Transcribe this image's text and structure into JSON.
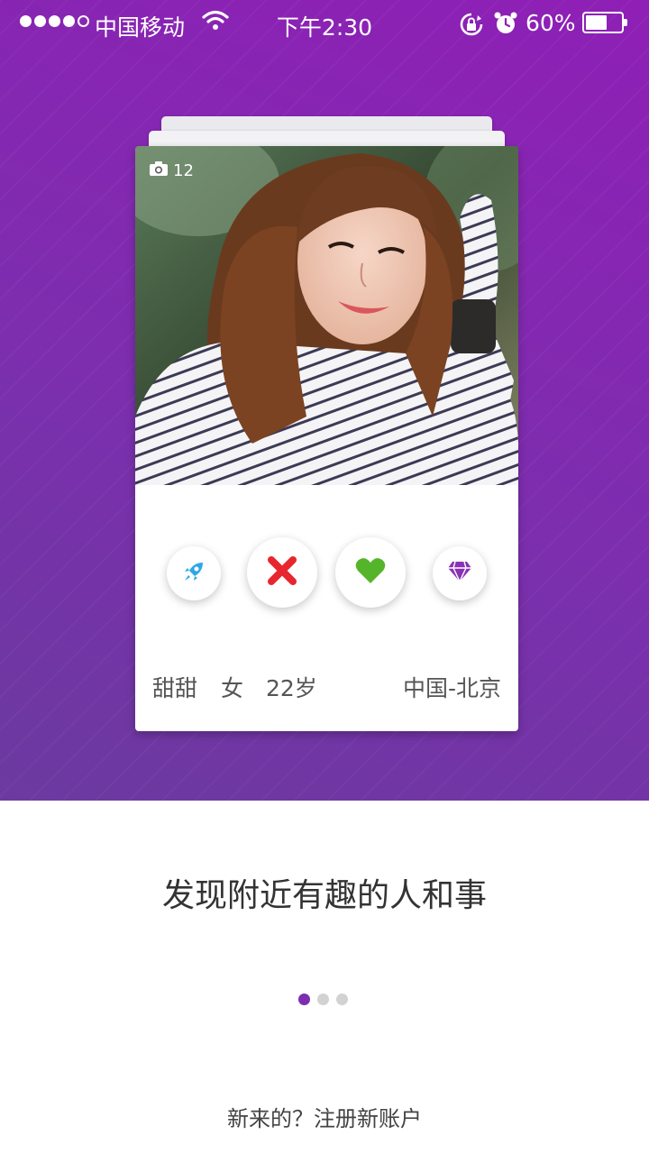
{
  "status_bar": {
    "signal_filled": 4,
    "carrier": "中国移动",
    "time": "下午2:30",
    "battery_percent": "60%",
    "battery_level": 0.6,
    "icons": [
      "signal-dots",
      "wifi-icon",
      "rotation-lock-icon",
      "alarm-clock-icon",
      "battery-icon"
    ]
  },
  "colors": {
    "hero_gradient_top": "#8f1fb6",
    "hero_gradient_bottom": "#6b3a9f",
    "reject": "#e8262e",
    "like": "#55b52a",
    "rocket": "#2ea7e8",
    "diamond": "#8a32b4",
    "page_dot_active": "#7b2fb0"
  },
  "card": {
    "photo_count": "12",
    "photo_icon": "camera-icon",
    "actions": [
      {
        "name": "boost",
        "icon": "rocket-icon"
      },
      {
        "name": "reject",
        "icon": "close-icon"
      },
      {
        "name": "like",
        "icon": "heart-icon"
      },
      {
        "name": "super-like",
        "icon": "diamond-icon"
      }
    ],
    "profile": {
      "name": "甜甜",
      "gender": "女",
      "age": "22岁",
      "location": "中国-北京"
    }
  },
  "tagline": "发现附近有趣的人和事",
  "pager": {
    "count": 3,
    "active_index": 0
  },
  "register_link": "新来的？注册新账户"
}
